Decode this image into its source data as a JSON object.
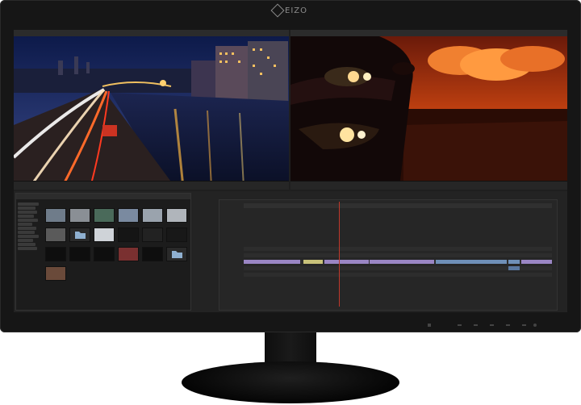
{
  "brand": {
    "logo_text": "EIZO"
  },
  "colors": {
    "bezel": "#161616",
    "timecode": "#d8b545",
    "playhead": "#c0392b",
    "clip_purple": "#9a86c4",
    "clip_blue": "#6f90b8"
  },
  "icons": [
    "eizo-logo-icon",
    "power-icon"
  ],
  "viewers": {
    "source": {
      "title": ""
    },
    "program": {
      "title": ""
    }
  }
}
